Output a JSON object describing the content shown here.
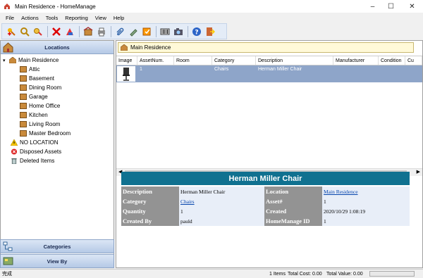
{
  "window": {
    "title": "Main Residence - HomeManage"
  },
  "menu": [
    "File",
    "Actions",
    "Tools",
    "Reporting",
    "View",
    "Help"
  ],
  "toolbar": {
    "buttons": [
      "add-item",
      "search",
      "find",
      "delete",
      "move",
      "rooms",
      "print",
      "attach",
      "edit",
      "barcode",
      "camera",
      "help",
      "exit"
    ]
  },
  "left": {
    "header": "Locations",
    "tree": {
      "root": "Main Residence",
      "rooms": [
        "Attic",
        "Basement",
        "Dining Room",
        "Garage",
        "Home Office",
        "Kitchen",
        "Living Room",
        "Master Bedroom"
      ],
      "no_location": "NO LOCATION",
      "disposed": "Disposed Assets",
      "deleted": "Deleted Items"
    },
    "categories": "Categories",
    "viewby": "View By"
  },
  "location_bar": "Main Residence",
  "grid": {
    "columns": [
      "Image",
      "AssetNum.",
      "Room",
      "Category",
      "Description",
      "Manufacturer",
      "Condition",
      "Cu"
    ],
    "rows": [
      {
        "image": "",
        "asset": "1",
        "room": "",
        "category": "Chairs",
        "description": "Herman Miller Chair",
        "manufacturer": "",
        "condition": ""
      }
    ]
  },
  "detail": {
    "title": "Herman Miller Chair",
    "rows": [
      {
        "l1": "Description",
        "v1": "Herman Miller Chair",
        "l2": "Location",
        "v2": "Main Residence"
      },
      {
        "l1": "Category",
        "v1": "Chairs",
        "l2": "Asset#",
        "v2": "1"
      },
      {
        "l1": "Quantity",
        "v1": "1",
        "l2": "Created",
        "v2": "2020/10/29 1:08:19"
      },
      {
        "l1": "Created By",
        "v1": "pauld",
        "l2": "HomeManage ID",
        "v2": "1"
      }
    ]
  },
  "status": {
    "left": "完成",
    "items": "1 Items",
    "cost": "Total Cost: 0.00",
    "value": "Total Value: 0.00"
  }
}
